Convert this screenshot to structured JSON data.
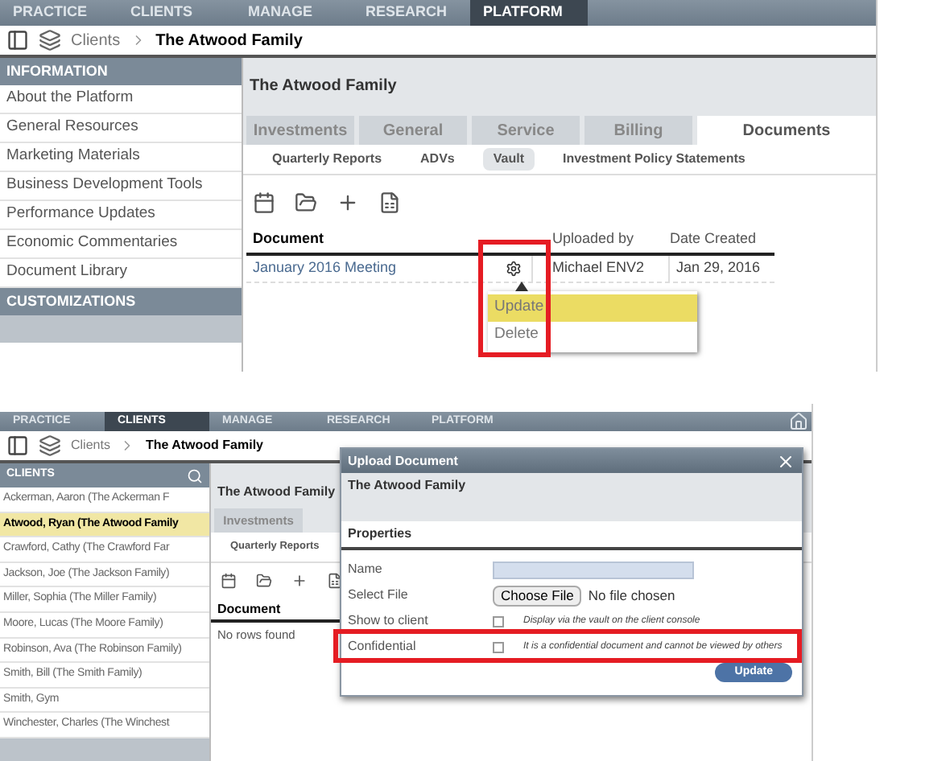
{
  "top_screen": {
    "nav": [
      {
        "label": "PRACTICE",
        "selected": false
      },
      {
        "label": "CLIENTS",
        "selected": false
      },
      {
        "label": "MANAGE",
        "selected": false
      },
      {
        "label": "RESEARCH",
        "selected": false
      },
      {
        "label": "PLATFORM",
        "selected": true
      }
    ],
    "breadcrumb": {
      "parent": "Clients",
      "current": "The Atwood Family"
    },
    "sidebar": [
      {
        "title": "INFORMATION",
        "items": [
          "About the Platform",
          "General Resources",
          "Marketing Materials",
          "Business Development Tools",
          "Performance Updates",
          "Economic Commentaries",
          "Document Library"
        ]
      },
      {
        "title": "CUSTOMIZATIONS"
      }
    ],
    "client_title": "The Atwood Family",
    "tabs": [
      {
        "label": "Investments",
        "selected": false
      },
      {
        "label": "General",
        "selected": false
      },
      {
        "label": "Service",
        "selected": false
      },
      {
        "label": "Billing",
        "selected": false
      },
      {
        "label": "Documents",
        "selected": true
      }
    ],
    "subtabs": [
      {
        "label": "Quarterly Reports",
        "selected": false
      },
      {
        "label": "ADVs",
        "selected": false
      },
      {
        "label": "Vault",
        "selected": true
      },
      {
        "label": "Investment Policy Statements",
        "selected": false
      }
    ],
    "table": {
      "columns": [
        "Document",
        "Uploaded by",
        "Date Created"
      ],
      "rows": [
        {
          "document": "January 2016 Meeting",
          "uploaded_by": "Michael ENV2",
          "date_created": "Jan 29, 2016"
        }
      ]
    },
    "context_menu": [
      {
        "label": "Update",
        "selected": true
      },
      {
        "label": "Delete",
        "selected": false
      }
    ]
  },
  "bottom_screen": {
    "nav": [
      {
        "label": "PRACTICE",
        "selected": false
      },
      {
        "label": "CLIENTS",
        "selected": true
      },
      {
        "label": "MANAGE",
        "selected": false
      },
      {
        "label": "RESEARCH",
        "selected": false
      },
      {
        "label": "PLATFORM",
        "selected": false
      }
    ],
    "breadcrumb": {
      "parent": "Clients",
      "current": "The Atwood Family"
    },
    "sidebar": {
      "title": "CLIENTS",
      "items": [
        {
          "label": "Ackerman, Aaron (The Ackerman F",
          "selected": false
        },
        {
          "label": "Atwood, Ryan (The Atwood Family",
          "selected": true
        },
        {
          "label": "Crawford, Cathy (The Crawford Far",
          "selected": false
        },
        {
          "label": "Jackson, Joe (The Jackson Family)",
          "selected": false
        },
        {
          "label": "Miller, Sophia (The Miller Family)",
          "selected": false
        },
        {
          "label": "Moore, Lucas (The Moore Family)",
          "selected": false
        },
        {
          "label": "Robinson, Ava (The Robinson Family)",
          "selected": false
        },
        {
          "label": "Smith, Bill (The Smith Family)",
          "selected": false
        },
        {
          "label": "Smith, Gym",
          "selected": false
        },
        {
          "label": "Winchester, Charles (The Winchest",
          "selected": false
        }
      ]
    },
    "client_title": "The Atwood Family",
    "tabs": [
      {
        "label": "Investments",
        "selected": false
      }
    ],
    "subtabs": [
      {
        "label": "Quarterly Reports",
        "selected": false
      }
    ],
    "table": {
      "columns": [
        "Document"
      ],
      "empty_message": "No rows found"
    },
    "dialog": {
      "title": "Upload Document",
      "client_name": "The Atwood Family",
      "section_title": "Properties",
      "fields": [
        {
          "kind": "text",
          "label": "Name"
        },
        {
          "kind": "file",
          "label": "Select File",
          "button": "Choose File",
          "status": "No file chosen"
        },
        {
          "kind": "checkbox",
          "label": "Show to client",
          "checked": false,
          "hint": "Display via the vault on the client console"
        },
        {
          "kind": "checkbox",
          "label": "Confidential",
          "checked": false,
          "hint": "It is a confidential document and cannot be viewed by others"
        }
      ],
      "submit": "Update"
    }
  }
}
